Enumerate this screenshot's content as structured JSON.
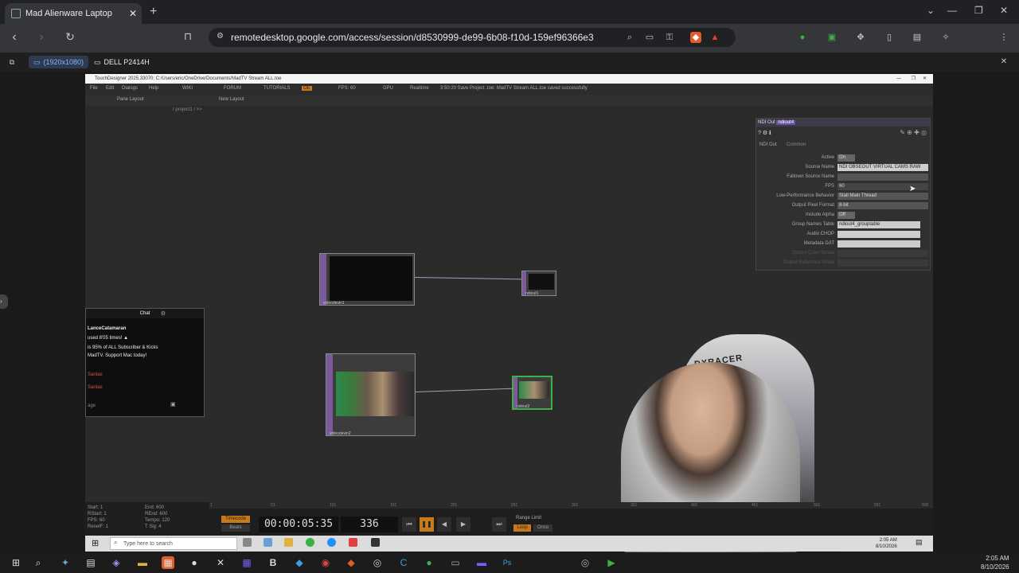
{
  "browser": {
    "tab_title": "Mad Alienware Laptop",
    "url": "remotedesktop.google.com/access/session/d8530999-de99-6b08-f10d-159ef96366e3"
  },
  "remote_bar": {
    "display_1": "(1920x1080)",
    "display_2": "DELL P2414H"
  },
  "td": {
    "title": "TouchDesigner 2025.33070: C:/Users/eric/OneDrive/Documents/MadTV Stream ALL.toe",
    "menu": [
      "File",
      "Edit",
      "Dialogs",
      "Help",
      "WIKI",
      "FORUM",
      "TUTORIALS",
      "OE",
      "FPS: 60",
      "GPU",
      "Realtime"
    ],
    "status": "3:50:20 Save Project .toe: MadTV Stream ALL.toe saved successfully",
    "pane_layout": "Pane Layout",
    "new_layout": "New Layout",
    "path": "/ project1 / >>",
    "nodes": {
      "n1": "videodevin1",
      "n2": "ndiout1",
      "n3": "videodevin2",
      "n4": "ndiout2"
    }
  },
  "params": {
    "op_type": "NDI Out",
    "op_name": "ndiout4",
    "tabs": [
      "NDI Out",
      "Common"
    ],
    "rows": [
      {
        "label": "Active",
        "value": "On"
      },
      {
        "label": "Source Name",
        "value": "NDI OBSEOUT VIRTUAL CAMS RAW"
      },
      {
        "label": "Fallover Source Name",
        "value": ""
      },
      {
        "label": "FPS",
        "value": "60"
      },
      {
        "label": "Low-Performance Behavior",
        "value": "Stall Main Thread"
      },
      {
        "label": "Output Pixel Format",
        "value": "8-bit"
      },
      {
        "label": "Include Alpha",
        "value": "Off"
      },
      {
        "label": "Group Names Table",
        "value": "ndiout4_grouptable"
      },
      {
        "label": "Audio CHOP",
        "value": ""
      },
      {
        "label": "Metadata DAT",
        "value": ""
      },
      {
        "label": "Output Color Space",
        "value": ""
      },
      {
        "label": "Output Reference White",
        "value": ""
      }
    ]
  },
  "chat": {
    "title": "Chat",
    "messages": [
      "LanceCatamaran",
      "used 8'05 times! ▲",
      "is 95% of ALL Subscriber & Kicks",
      "MadTV. Support Mac today!",
      "Santas",
      "Santas"
    ],
    "input_placeholder": "age"
  },
  "timeline": {
    "info": [
      "Start: 1",
      "RStart: 1",
      "FPS: 60",
      "ResetF: 1"
    ],
    "info2": [
      "End: 600",
      "REnd: 600",
      "Tempo: 120",
      "T Sig: 4"
    ],
    "timecode": "00:00:05:35",
    "frame": "336",
    "timecode_label": "Timecode",
    "beats_label": "Beats",
    "range_limit": "Range Limit",
    "loop": "Loop",
    "once": "Once",
    "ticks": [
      "1",
      "51",
      "101",
      "151",
      "201",
      "251",
      "301",
      "351",
      "401",
      "451",
      "501",
      "551",
      "600"
    ]
  },
  "remote_taskbar": {
    "search_placeholder": "Type here to search",
    "clock_time": "2:05 AM",
    "clock_date": "8/10/2026"
  },
  "webcam": {
    "chair_brand": "DXRACER"
  },
  "host_taskbar": {
    "time": "2:05 AM",
    "date": "8/10/2026"
  }
}
